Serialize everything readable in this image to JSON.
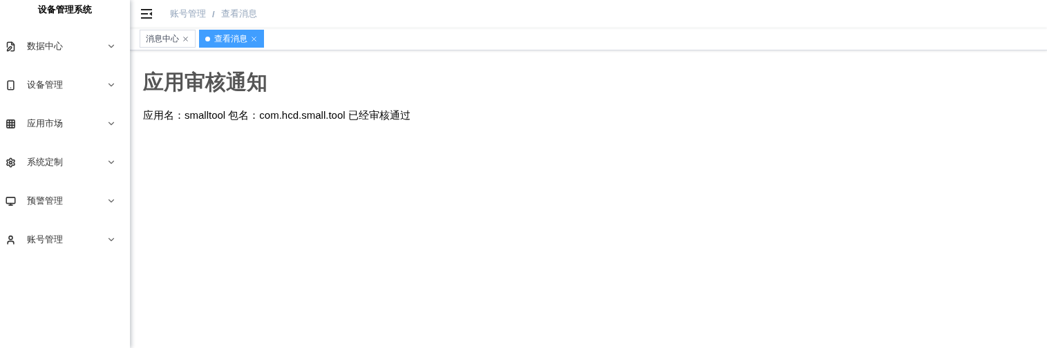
{
  "sidebar": {
    "title": "设备管理系统",
    "items": [
      {
        "label": "数据中心",
        "expanded": false
      },
      {
        "label": "设备管理",
        "expanded": false
      },
      {
        "label": "应用市场",
        "expanded": false
      },
      {
        "label": "系统定制",
        "expanded": false
      },
      {
        "label": "预警管理",
        "expanded": false
      },
      {
        "label": "账号管理",
        "expanded": false
      }
    ]
  },
  "breadcrumb": {
    "separator": "/",
    "items": [
      "账号管理",
      "查看消息"
    ]
  },
  "tabs": [
    {
      "label": "消息中心",
      "selected": false
    },
    {
      "label": "查看消息",
      "selected": true
    }
  ],
  "content": {
    "heading": "应用审核通知",
    "message": "应用名：smalltool 包名：com.hcd.small.tool 已经审核通过"
  }
}
